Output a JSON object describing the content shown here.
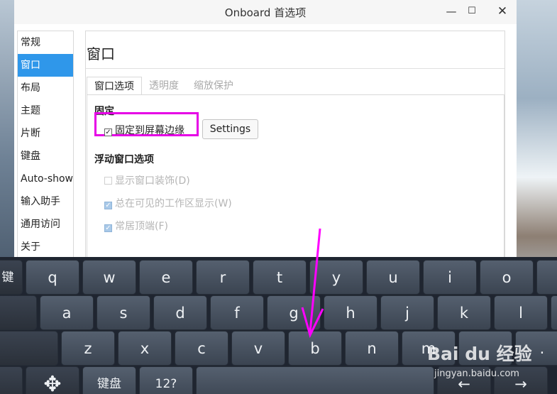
{
  "window": {
    "title": "Onboard 首选项",
    "controls": {
      "minimize": "—",
      "maximize": "☐",
      "close": "✕"
    }
  },
  "sidebar": {
    "items": [
      {
        "label": "常规"
      },
      {
        "label": "窗口",
        "active": true
      },
      {
        "label": "布局"
      },
      {
        "label": "主题"
      },
      {
        "label": "片断"
      },
      {
        "label": "键盘"
      },
      {
        "label": "Auto-show"
      },
      {
        "label": "输入助手"
      },
      {
        "label": "通用访问"
      },
      {
        "label": "关于"
      }
    ]
  },
  "main": {
    "page_title": "窗口",
    "tabs": [
      {
        "label": "窗口选项",
        "active": true
      },
      {
        "label": "透明度"
      },
      {
        "label": "缩放保护"
      }
    ],
    "docking": {
      "heading": "固定",
      "dock_to_edge": {
        "label": "固定到屏幕边缘",
        "checked": true
      },
      "settings_button": "Settings"
    },
    "floating": {
      "heading": "浮动窗口选项",
      "options": [
        {
          "label": "显示窗口装饰(D)",
          "checked": false,
          "enabled": false
        },
        {
          "label": "总在可见的工作区显示(W)",
          "checked": true,
          "enabled": false
        },
        {
          "label": "常居顶端(F)",
          "checked": true,
          "enabled": false
        }
      ]
    }
  },
  "keyboard": {
    "row1": [
      "键",
      "q",
      "w",
      "e",
      "r",
      "t",
      "y",
      "u",
      "i",
      "o"
    ],
    "row2": [
      "a",
      "s",
      "d",
      "f",
      "g",
      "h",
      "j",
      "k",
      "l"
    ],
    "row3": [
      "z",
      "x",
      "c",
      "v",
      "b",
      "n",
      "m",
      "."
    ],
    "row4": {
      "move": "✥",
      "layout": "键盘",
      "numbers": "12?",
      "left": "←",
      "right": "→"
    }
  },
  "watermark": {
    "logo": "Bai du 经验",
    "url": "jingyan.baidu.com"
  },
  "colors": {
    "accent": "#2f97ea",
    "highlight": "#e600e6",
    "arrow": "#ff00ff"
  }
}
